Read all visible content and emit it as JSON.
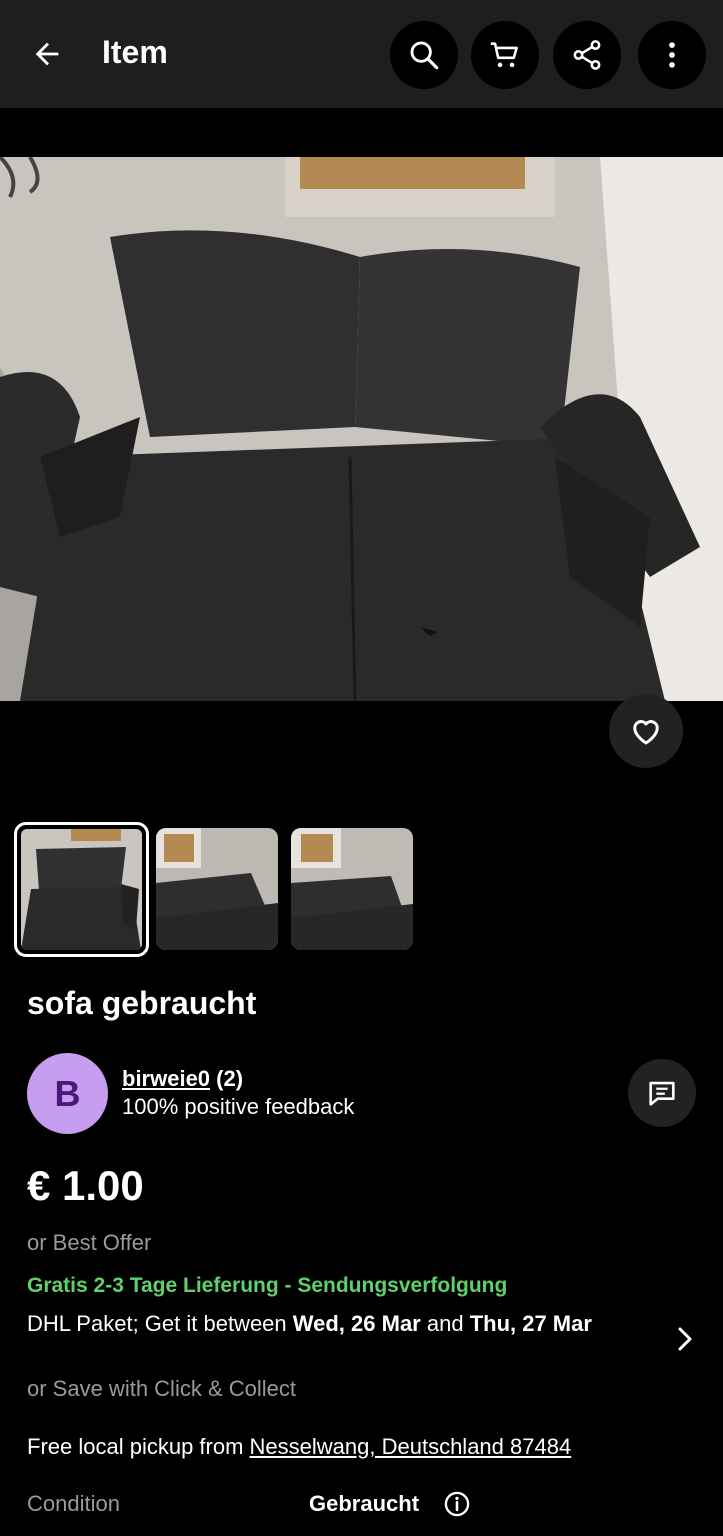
{
  "header": {
    "title": "Item",
    "icons": [
      "back-arrow-icon",
      "search-icon",
      "cart-icon",
      "share-icon",
      "more-vert-icon"
    ]
  },
  "listing": {
    "title": "sofa gebraucht",
    "photo_count": 3,
    "selected_photo": 1
  },
  "seller": {
    "avatar_letter": "B",
    "name": "birweie0",
    "rating_count": "(2)",
    "feedback": "100% positive feedback",
    "avatar_color": "#c79df0"
  },
  "price": {
    "amount": "€ 1.00",
    "best_offer": "or Best Offer"
  },
  "shipping": {
    "headline": "Gratis 2-3 Tage Lieferung - Sendungsverfolgung",
    "carrier_prefix": "DHL Paket; Get it between ",
    "date_from": "Wed, 26 Mar",
    "and_word": " and ",
    "date_to": "Thu, 27 Mar",
    "click_collect": "or Save with Click & Collect",
    "headline_color": "#5fd06a"
  },
  "pickup": {
    "prefix": "Free local pickup from ",
    "location": "Nesselwang, Deutschland 87484"
  },
  "condition": {
    "label": "Condition",
    "value": "Gebraucht"
  }
}
